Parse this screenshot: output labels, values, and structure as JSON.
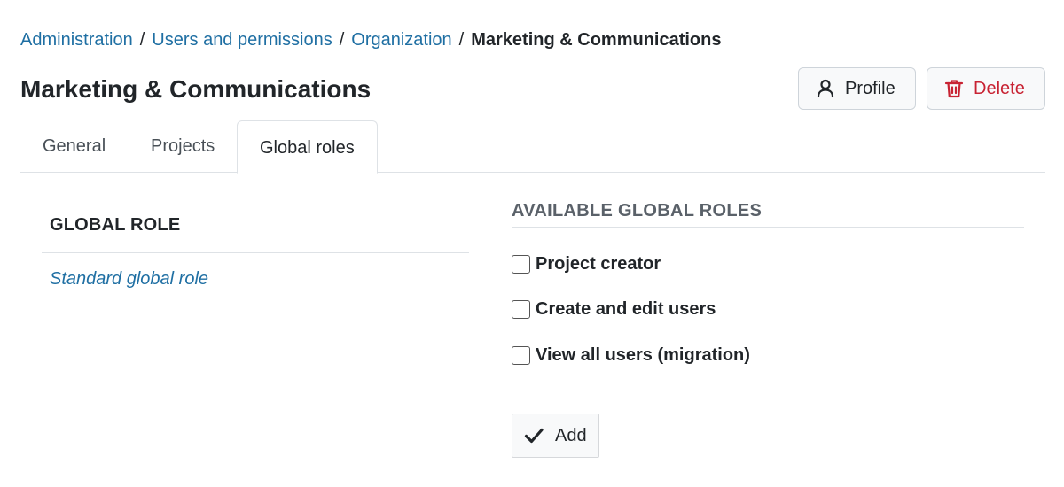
{
  "breadcrumb": {
    "items": [
      "Administration",
      "Users and permissions",
      "Organization"
    ],
    "separator": "/",
    "current": "Marketing & Communications"
  },
  "page": {
    "title": "Marketing & Communications"
  },
  "actions": {
    "profile": {
      "label": "Profile",
      "icon": "user-icon"
    },
    "delete": {
      "label": "Delete",
      "icon": "trash-icon",
      "color": "#c82333"
    }
  },
  "tabs": [
    {
      "label": "General",
      "active": false
    },
    {
      "label": "Projects",
      "active": false
    },
    {
      "label": "Global roles",
      "active": true
    }
  ],
  "roles_table": {
    "header": "GLOBAL ROLE",
    "rows": [
      "Standard global role"
    ]
  },
  "available_roles": {
    "title": "AVAILABLE GLOBAL ROLES",
    "options": [
      {
        "label": "Project creator",
        "checked": false
      },
      {
        "label": "Create and edit users",
        "checked": false
      },
      {
        "label": "View all users (migration)",
        "checked": false
      }
    ],
    "add_label": "Add",
    "add_icon": "checkmark-icon"
  },
  "colors": {
    "link": "#1f6fa3",
    "danger": "#c82333",
    "text": "#212529"
  }
}
